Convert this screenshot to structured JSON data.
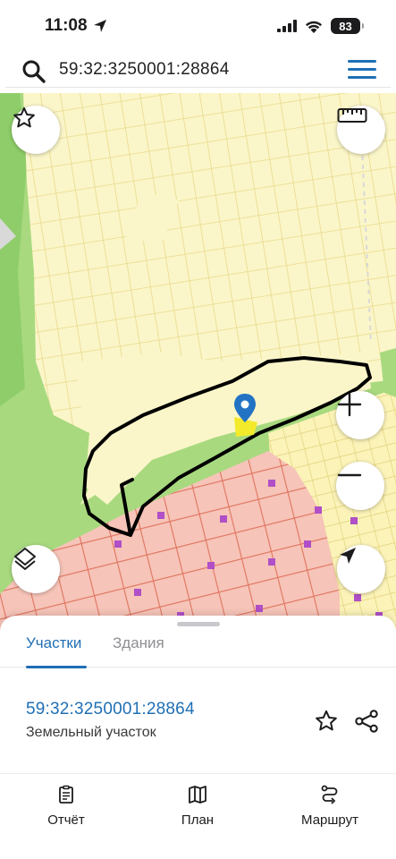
{
  "status_bar": {
    "time": "11:08",
    "battery": "83"
  },
  "search": {
    "value": "59:32:3250001:28864"
  },
  "sheet": {
    "tabs": [
      {
        "label": "Участки",
        "active": true
      },
      {
        "label": "Здания",
        "active": false
      }
    ],
    "parcel": {
      "number": "59:32:3250001:28864",
      "type": "Земельный участок"
    }
  },
  "bottom_nav": [
    {
      "label": "Отчёт",
      "icon": "report-icon"
    },
    {
      "label": "План",
      "icon": "map-plan-icon"
    },
    {
      "label": "Маршрут",
      "icon": "route-icon"
    }
  ],
  "colors": {
    "accent": "#1f6fb5",
    "map_yellow": "#fbf6c9",
    "map_green": "#a8d97f",
    "parcel_red_fill": "#f6c4b8",
    "parcel_red_line": "#e0735f"
  }
}
